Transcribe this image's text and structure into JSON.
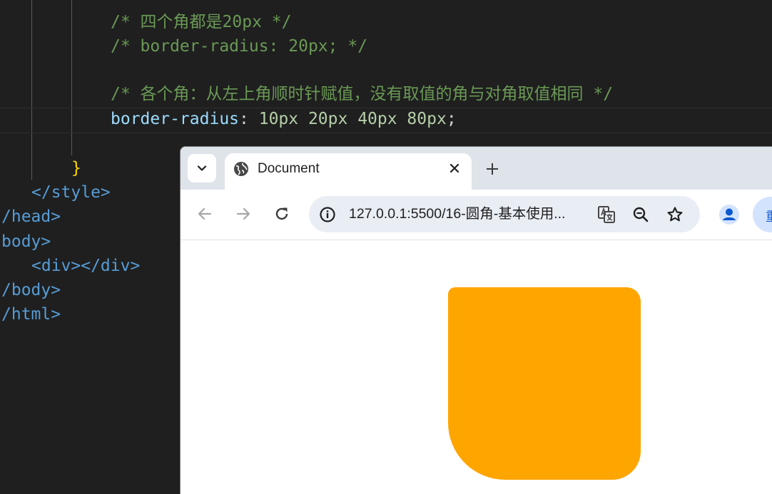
{
  "editor": {
    "comment_1": "/* 四个角都是20px */",
    "comment_2": "/* border-radius: 20px; */",
    "comment_3": "/* 各个角：从左上角顺时针赋值，没有取值的角与对角取值相同 */",
    "decl_property": "border-radius",
    "decl_colon": ":",
    "decl_values": " 10px 20px 40px 80px",
    "decl_semicolon": ";",
    "brace": "}",
    "line_style_close": "</style>",
    "line_head_close": "/head>",
    "line_body_open": "body>",
    "line_div": "<div></div>",
    "line_body_close": "/body>",
    "line_html_close": "/html>"
  },
  "browser": {
    "tab_title": "Document",
    "new_tab_symbol": "+",
    "url": "127.0.0.1:5500/16-圆角-基本使用...",
    "profile_partial": "重"
  },
  "page": {
    "box_color": "#ffa500",
    "border_radius": "10px 20px 40px 80px"
  },
  "colors": {
    "editor_bg": "#1f1f1f",
    "comment": "#6a9955",
    "property": "#9cdcfe",
    "number": "#b5cea8",
    "tag": "#569cd6",
    "tabstrip_bg": "#dfe3ea",
    "omnibox_bg": "#e9edf4"
  }
}
